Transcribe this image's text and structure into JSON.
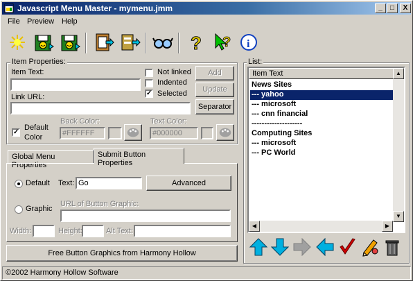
{
  "window": {
    "title": "Javascript Menu Master - mymenu.jmm",
    "min_glyph": "_",
    "max_glyph": "□",
    "close_glyph": "X"
  },
  "menu": [
    "File",
    "Preview",
    "Help"
  ],
  "toolbar": [
    "new-icon",
    "save-icon",
    "save-as-icon",
    "copy-to-clipboard-icon",
    "export-icon",
    "preview-glasses-icon",
    "help-icon",
    "context-help-icon",
    "info-icon"
  ],
  "item_properties": {
    "group_label": "Item Properties:",
    "item_text_label": "Item Text:",
    "item_text_value": "",
    "link_url_label": "Link URL:",
    "link_url_value": "",
    "not_linked_label": "Not linked",
    "not_linked_checked": false,
    "indented_label": "Indented",
    "indented_checked": false,
    "selected_label": "Selected",
    "selected_checked": true,
    "add_label": "Add",
    "update_label": "Update",
    "separator_label": "Separator",
    "default_color_label_1": "Default",
    "default_color_label_2": "Color",
    "default_color_checked": true,
    "back_color_label": "Back Color:",
    "back_color_value": "#FFFFFF",
    "text_color_label": "Text Color:",
    "text_color_value": "#000000",
    "check_glyph": "✓"
  },
  "tabs": [
    "Global Menu Properties",
    "Submit Button Properties"
  ],
  "submit": {
    "default_label": "Default",
    "text_label": "Text:",
    "text_value": "Go",
    "advanced_label": "Advanced",
    "graphic_label": "Graphic",
    "url_graphic_label": "URL of Button Graphic:",
    "url_graphic_value": "",
    "width_label": "Width:",
    "width_value": "",
    "height_label": "Height:",
    "height_value": "",
    "alt_label": "Alt Text:",
    "alt_value": ""
  },
  "free_graphics_label": "Free Button Graphics from Harmony Hollow",
  "list": {
    "group_label": "List:",
    "column_header": "Item Text",
    "rows": [
      "News Sites",
      "--- yahoo",
      "--- microsoft",
      "--- cnn financial",
      "--------------------",
      "Computing Sites",
      "--- microsoft",
      "--- PC World"
    ],
    "selected_index": 1
  },
  "action_buttons": [
    "move-up-icon",
    "move-down-icon",
    "move-right-disabled-icon",
    "move-left-icon",
    "check-icon",
    "edit-pencil-icon",
    "delete-trash-icon"
  ],
  "status": "©2002 Harmony Hollow Software",
  "colors": {
    "title_start": "#0a246a",
    "title_end": "#a6caf0",
    "selection": "#0a246a",
    "arrow_cyan": "#00b0e0",
    "check_red": "#d00000"
  }
}
